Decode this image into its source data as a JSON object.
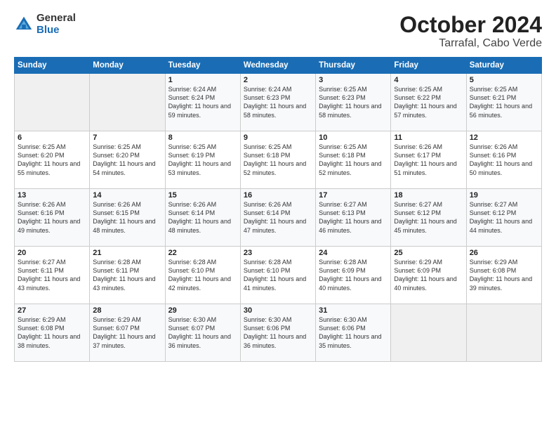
{
  "header": {
    "logo_general": "General",
    "logo_blue": "Blue",
    "title": "October 2024",
    "location": "Tarrafal, Cabo Verde"
  },
  "days_of_week": [
    "Sunday",
    "Monday",
    "Tuesday",
    "Wednesday",
    "Thursday",
    "Friday",
    "Saturday"
  ],
  "weeks": [
    [
      {
        "day": "",
        "info": ""
      },
      {
        "day": "",
        "info": ""
      },
      {
        "day": "1",
        "info": "Sunrise: 6:24 AM\nSunset: 6:24 PM\nDaylight: 11 hours and 59 minutes."
      },
      {
        "day": "2",
        "info": "Sunrise: 6:24 AM\nSunset: 6:23 PM\nDaylight: 11 hours and 58 minutes."
      },
      {
        "day": "3",
        "info": "Sunrise: 6:25 AM\nSunset: 6:23 PM\nDaylight: 11 hours and 58 minutes."
      },
      {
        "day": "4",
        "info": "Sunrise: 6:25 AM\nSunset: 6:22 PM\nDaylight: 11 hours and 57 minutes."
      },
      {
        "day": "5",
        "info": "Sunrise: 6:25 AM\nSunset: 6:21 PM\nDaylight: 11 hours and 56 minutes."
      }
    ],
    [
      {
        "day": "6",
        "info": "Sunrise: 6:25 AM\nSunset: 6:20 PM\nDaylight: 11 hours and 55 minutes."
      },
      {
        "day": "7",
        "info": "Sunrise: 6:25 AM\nSunset: 6:20 PM\nDaylight: 11 hours and 54 minutes."
      },
      {
        "day": "8",
        "info": "Sunrise: 6:25 AM\nSunset: 6:19 PM\nDaylight: 11 hours and 53 minutes."
      },
      {
        "day": "9",
        "info": "Sunrise: 6:25 AM\nSunset: 6:18 PM\nDaylight: 11 hours and 52 minutes."
      },
      {
        "day": "10",
        "info": "Sunrise: 6:25 AM\nSunset: 6:18 PM\nDaylight: 11 hours and 52 minutes."
      },
      {
        "day": "11",
        "info": "Sunrise: 6:26 AM\nSunset: 6:17 PM\nDaylight: 11 hours and 51 minutes."
      },
      {
        "day": "12",
        "info": "Sunrise: 6:26 AM\nSunset: 6:16 PM\nDaylight: 11 hours and 50 minutes."
      }
    ],
    [
      {
        "day": "13",
        "info": "Sunrise: 6:26 AM\nSunset: 6:16 PM\nDaylight: 11 hours and 49 minutes."
      },
      {
        "day": "14",
        "info": "Sunrise: 6:26 AM\nSunset: 6:15 PM\nDaylight: 11 hours and 48 minutes."
      },
      {
        "day": "15",
        "info": "Sunrise: 6:26 AM\nSunset: 6:14 PM\nDaylight: 11 hours and 48 minutes."
      },
      {
        "day": "16",
        "info": "Sunrise: 6:26 AM\nSunset: 6:14 PM\nDaylight: 11 hours and 47 minutes."
      },
      {
        "day": "17",
        "info": "Sunrise: 6:27 AM\nSunset: 6:13 PM\nDaylight: 11 hours and 46 minutes."
      },
      {
        "day": "18",
        "info": "Sunrise: 6:27 AM\nSunset: 6:12 PM\nDaylight: 11 hours and 45 minutes."
      },
      {
        "day": "19",
        "info": "Sunrise: 6:27 AM\nSunset: 6:12 PM\nDaylight: 11 hours and 44 minutes."
      }
    ],
    [
      {
        "day": "20",
        "info": "Sunrise: 6:27 AM\nSunset: 6:11 PM\nDaylight: 11 hours and 43 minutes."
      },
      {
        "day": "21",
        "info": "Sunrise: 6:28 AM\nSunset: 6:11 PM\nDaylight: 11 hours and 43 minutes."
      },
      {
        "day": "22",
        "info": "Sunrise: 6:28 AM\nSunset: 6:10 PM\nDaylight: 11 hours and 42 minutes."
      },
      {
        "day": "23",
        "info": "Sunrise: 6:28 AM\nSunset: 6:10 PM\nDaylight: 11 hours and 41 minutes."
      },
      {
        "day": "24",
        "info": "Sunrise: 6:28 AM\nSunset: 6:09 PM\nDaylight: 11 hours and 40 minutes."
      },
      {
        "day": "25",
        "info": "Sunrise: 6:29 AM\nSunset: 6:09 PM\nDaylight: 11 hours and 40 minutes."
      },
      {
        "day": "26",
        "info": "Sunrise: 6:29 AM\nSunset: 6:08 PM\nDaylight: 11 hours and 39 minutes."
      }
    ],
    [
      {
        "day": "27",
        "info": "Sunrise: 6:29 AM\nSunset: 6:08 PM\nDaylight: 11 hours and 38 minutes."
      },
      {
        "day": "28",
        "info": "Sunrise: 6:29 AM\nSunset: 6:07 PM\nDaylight: 11 hours and 37 minutes."
      },
      {
        "day": "29",
        "info": "Sunrise: 6:30 AM\nSunset: 6:07 PM\nDaylight: 11 hours and 36 minutes."
      },
      {
        "day": "30",
        "info": "Sunrise: 6:30 AM\nSunset: 6:06 PM\nDaylight: 11 hours and 36 minutes."
      },
      {
        "day": "31",
        "info": "Sunrise: 6:30 AM\nSunset: 6:06 PM\nDaylight: 11 hours and 35 minutes."
      },
      {
        "day": "",
        "info": ""
      },
      {
        "day": "",
        "info": ""
      }
    ]
  ]
}
